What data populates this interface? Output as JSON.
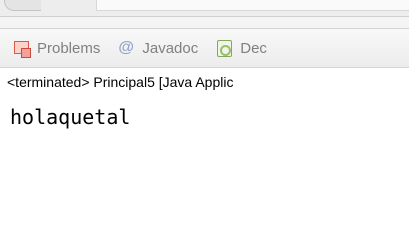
{
  "tabs": [
    {
      "label": "Problems",
      "icon": "problems-icon"
    },
    {
      "label": "Javadoc",
      "icon": "at-icon"
    },
    {
      "label": "Dec",
      "icon": "declaration-icon"
    }
  ],
  "process_status": "<terminated> Principal5 [Java Applic",
  "console_output": "holaquetal",
  "colors": {
    "tab_text": "#808080",
    "console_text": "#000000",
    "accent_error": "#d75a4a"
  }
}
